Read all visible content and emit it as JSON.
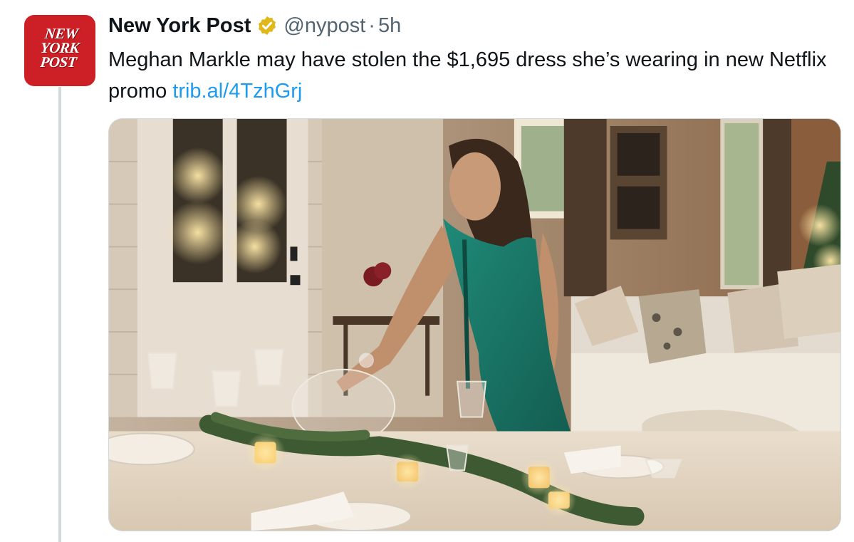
{
  "tweet": {
    "avatar_logo_text": "NEW\nYORK\nPOST",
    "author_name": "New York Post",
    "verified_icon": "verified-badge-gold",
    "handle": "@nypost",
    "separator": "·",
    "time": "5h",
    "text": "Meghan Markle may have stolen the $1,695 dress she’s wearing in new Netflix promo ",
    "link_text": "trib.al/4TzhGrj"
  },
  "colors": {
    "avatar_bg": "#cc1f26",
    "link": "#1d9bf0",
    "secondary_text": "#536471",
    "verified_gold": "#e2b719",
    "thread_line": "#cfd9de"
  },
  "media": {
    "type": "photo",
    "icon": "photo-image"
  }
}
